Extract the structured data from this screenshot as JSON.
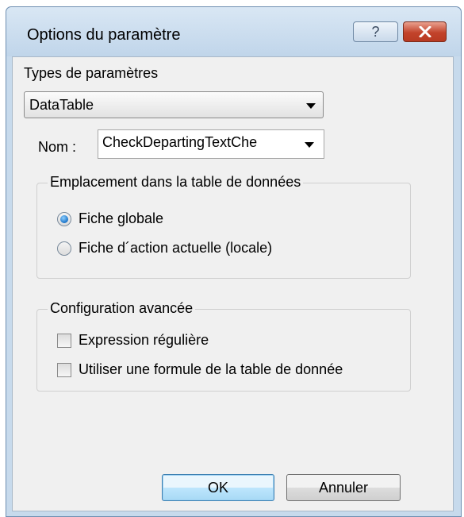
{
  "window": {
    "title": "Options du paramètre"
  },
  "titlebar_buttons": {
    "help": "?",
    "close_icon": "close-x-icon"
  },
  "param_types": {
    "label": "Types de paramètres",
    "selected": "DataTable"
  },
  "name_field": {
    "label": "Nom :",
    "value": "CheckDepartingTextChe"
  },
  "location_group": {
    "legend": "Emplacement dans la table de données",
    "options": [
      {
        "label": "Fiche globale",
        "selected": true
      },
      {
        "label": "Fiche d´action actuelle (locale)",
        "selected": false
      }
    ]
  },
  "advanced_group": {
    "legend": "Configuration avancée",
    "options": [
      {
        "label": "Expression régulière",
        "checked": false
      },
      {
        "label": "Utiliser une formule de la table de donnée",
        "checked": false
      }
    ]
  },
  "buttons": {
    "ok": "OK",
    "cancel": "Annuler"
  },
  "colors": {
    "title_bar": "#c7daec",
    "close_button": "#c2432b",
    "radio_selected": "#1a73c8"
  }
}
